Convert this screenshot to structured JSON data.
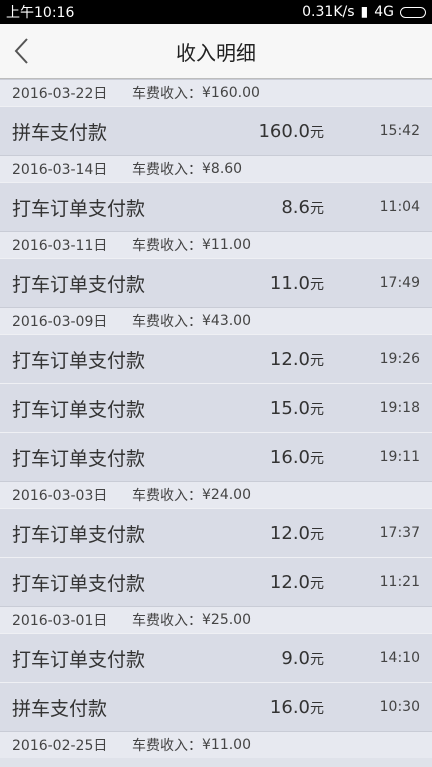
{
  "status": {
    "time": "上午10:16",
    "speed": "0.31K/s",
    "network": "4G"
  },
  "header": {
    "title": "收入明细"
  },
  "labels": {
    "income": "车费收入：",
    "currency": "¥",
    "unit": "元"
  },
  "groups": [
    {
      "date": "2016-03-22日",
      "total": "160.00",
      "items": [
        {
          "name": "拼车支付款",
          "amount": "160.0",
          "time": "15:42"
        }
      ]
    },
    {
      "date": "2016-03-14日",
      "total": "8.60",
      "items": [
        {
          "name": "打车订单支付款",
          "amount": "8.6",
          "time": "11:04"
        }
      ]
    },
    {
      "date": "2016-03-11日",
      "total": "11.00",
      "items": [
        {
          "name": "打车订单支付款",
          "amount": "11.0",
          "time": "17:49"
        }
      ]
    },
    {
      "date": "2016-03-09日",
      "total": "43.00",
      "items": [
        {
          "name": "打车订单支付款",
          "amount": "12.0",
          "time": "19:26"
        },
        {
          "name": "打车订单支付款",
          "amount": "15.0",
          "time": "19:18"
        },
        {
          "name": "打车订单支付款",
          "amount": "16.0",
          "time": "19:11"
        }
      ]
    },
    {
      "date": "2016-03-03日",
      "total": "24.00",
      "items": [
        {
          "name": "打车订单支付款",
          "amount": "12.0",
          "time": "17:37"
        },
        {
          "name": "打车订单支付款",
          "amount": "12.0",
          "time": "11:21"
        }
      ]
    },
    {
      "date": "2016-03-01日",
      "total": "25.00",
      "items": [
        {
          "name": "打车订单支付款",
          "amount": "9.0",
          "time": "14:10"
        },
        {
          "name": "拼车支付款",
          "amount": "16.0",
          "time": "10:30"
        }
      ]
    },
    {
      "date": "2016-02-25日",
      "total": "11.00",
      "items": []
    }
  ]
}
